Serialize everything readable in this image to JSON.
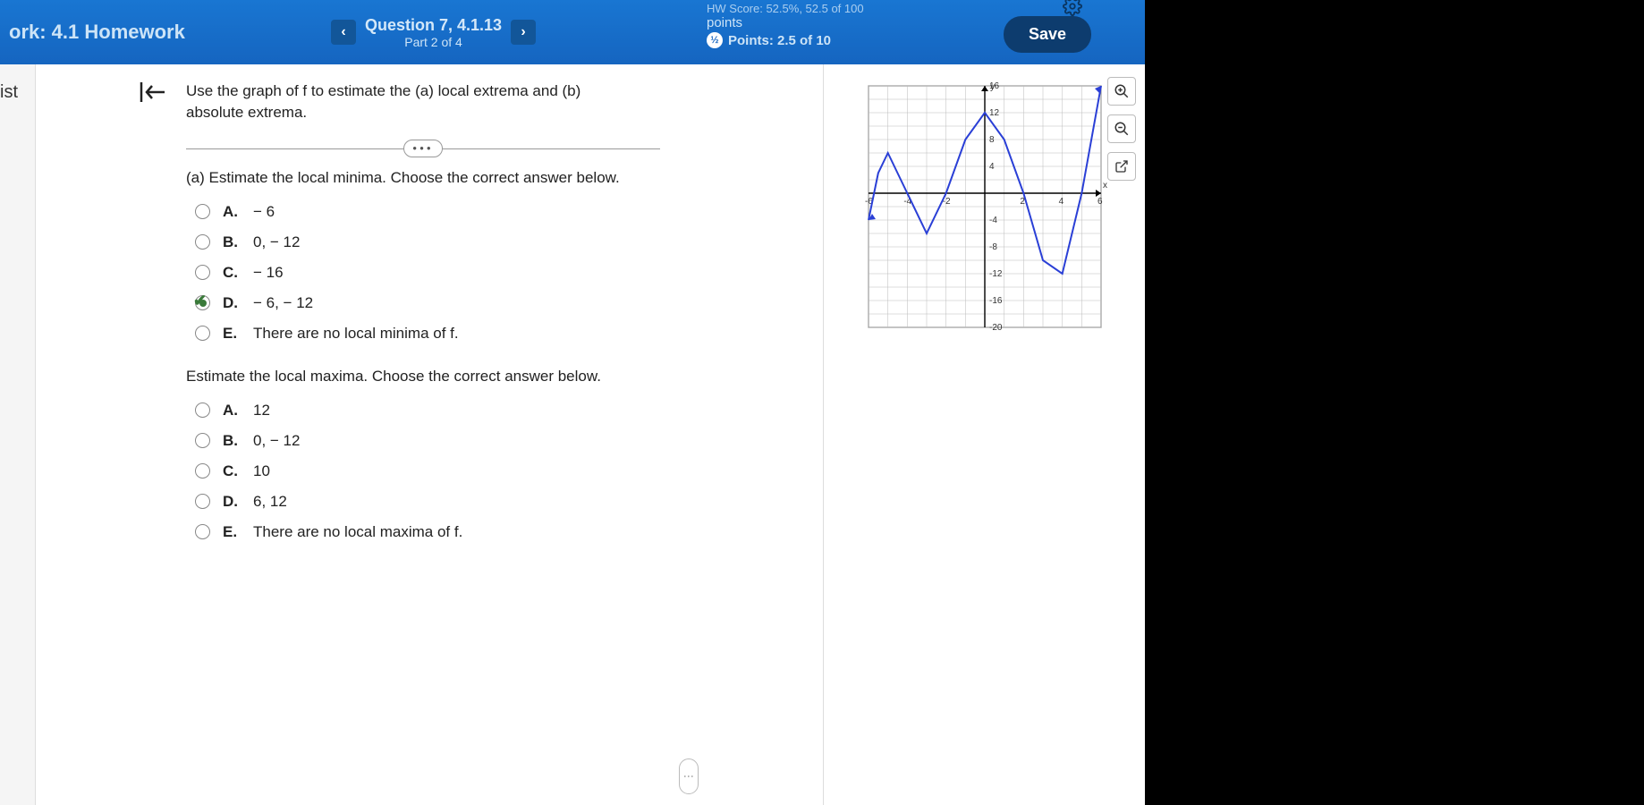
{
  "header": {
    "hw_title": "ork: 4.1 Homework",
    "question_title": "Question 7, 4.1.13",
    "part": "Part 2 of 4",
    "score_top": "HW Score: 52.5%, 52.5 of 100",
    "points_label": "points",
    "points_value": "Points: 2.5 of 10",
    "save": "Save"
  },
  "sidebar": {
    "list_stub": "ist"
  },
  "question": {
    "prompt": "Use the graph of f to estimate the (a) local extrema and (b) absolute extrema.",
    "part_a": "(a) Estimate the local minima. Choose the correct answer below.",
    "part_a2": "Estimate the local maxima. Choose the correct answer below.",
    "options_a": [
      {
        "letter": "A.",
        "text": "− 6"
      },
      {
        "letter": "B.",
        "text": "0, − 12"
      },
      {
        "letter": "C.",
        "text": "− 16"
      },
      {
        "letter": "D.",
        "text": "− 6, − 12"
      },
      {
        "letter": "E.",
        "text": "There are no local minima of f."
      }
    ],
    "options_b": [
      {
        "letter": "A.",
        "text": "12"
      },
      {
        "letter": "B.",
        "text": "0, − 12"
      },
      {
        "letter": "C.",
        "text": "10"
      },
      {
        "letter": "D.",
        "text": "6, 12"
      },
      {
        "letter": "E.",
        "text": "There are no local maxima of f."
      }
    ],
    "selected_a": 3
  },
  "chart_data": {
    "type": "line",
    "xlabel": "x",
    "ylabel": "y",
    "xlim": [
      -6,
      6
    ],
    "ylim": [
      -20,
      16
    ],
    "xticks": [
      -6,
      -4,
      -2,
      2,
      4,
      6
    ],
    "yticks": [
      16,
      12,
      8,
      4,
      -4,
      -8,
      -12,
      -16,
      -20
    ],
    "series": [
      {
        "name": "f",
        "x": [
          -6,
          -5.5,
          -5,
          -4,
          -3,
          -2,
          -1,
          0,
          1,
          2,
          3,
          4,
          5,
          6
        ],
        "y": [
          -4,
          3,
          6,
          0,
          -6,
          0,
          8,
          12,
          8,
          0,
          -10,
          -12,
          0,
          16
        ]
      }
    ]
  }
}
